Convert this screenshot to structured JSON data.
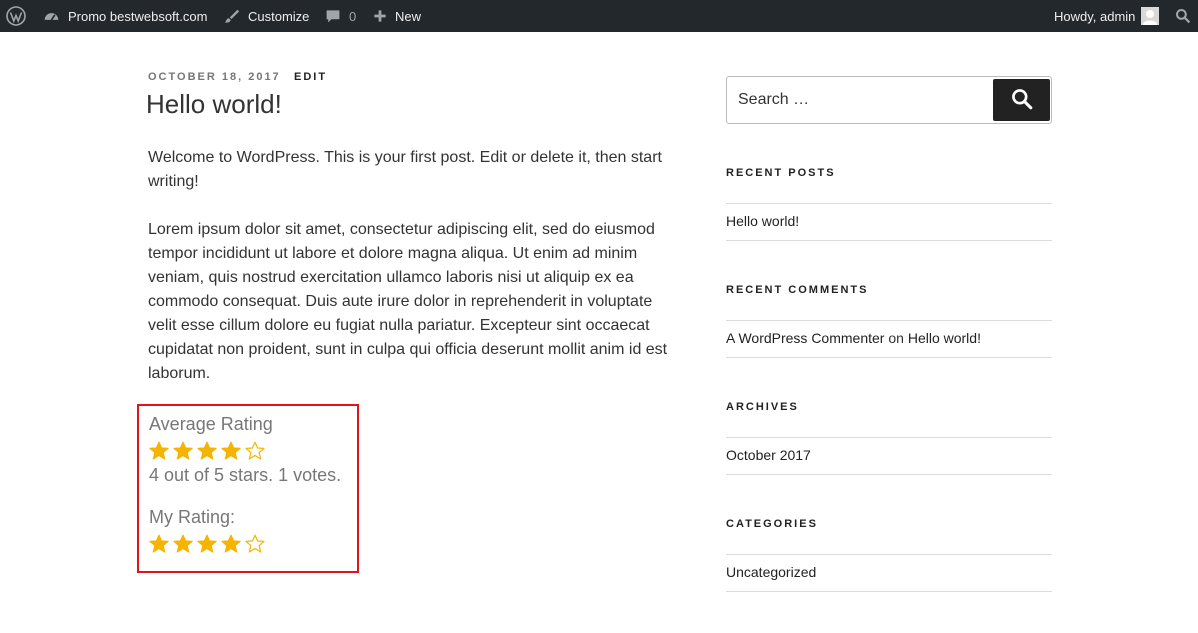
{
  "admin_bar": {
    "site_name": "Promo bestwebsoft.com",
    "customize": "Customize",
    "comments_count": "0",
    "new": "New",
    "greeting": "Howdy, admin"
  },
  "post": {
    "date": "OCTOBER 18, 2017",
    "edit": "EDIT",
    "title": "Hello world!",
    "paragraph_1": "Welcome to WordPress. This is your first post. Edit or delete it, then start writing!",
    "paragraph_2": "Lorem ipsum dolor sit amet, consectetur adipiscing elit, sed do eiusmod tempor incididunt ut labore et dolore magna aliqua. Ut enim ad minim veniam, quis nostrud exercitation ullamco laboris nisi ut aliquip ex ea commodo consequat. Duis aute irure dolor in reprehenderit in voluptate velit esse cillum dolore eu fugiat nulla pariatur. Excepteur sint occaecat cupidatat non proident, sunt in culpa qui officia deserunt mollit anim id est laborum."
  },
  "rating": {
    "average_label": "Average Rating",
    "average_stars": 4,
    "max_stars": 5,
    "summary": "4 out of 5 stars. 1 votes.",
    "my_label": "My Rating:",
    "my_stars": 4,
    "star_color": "#f5b400"
  },
  "sidebar": {
    "search_placeholder": "Search …",
    "recent_posts_title": "RECENT POSTS",
    "recent_posts": [
      "Hello world!"
    ],
    "recent_comments_title": "RECENT COMMENTS",
    "comment_author": "A WordPress Commenter",
    "comment_on": "on",
    "comment_post": "Hello world!",
    "archives_title": "ARCHIVES",
    "archives": [
      "October 2017"
    ],
    "categories_title": "CATEGORIES",
    "categories": [
      "Uncategorized"
    ]
  },
  "icons": {
    "wp": "wordpress-logo-icon",
    "dashboard": "dashboard-icon",
    "customize": "paintbrush-icon",
    "comments": "comment-bubble-icon",
    "new": "plus-icon",
    "avatar": "avatar-icon",
    "search": "search-icon"
  }
}
